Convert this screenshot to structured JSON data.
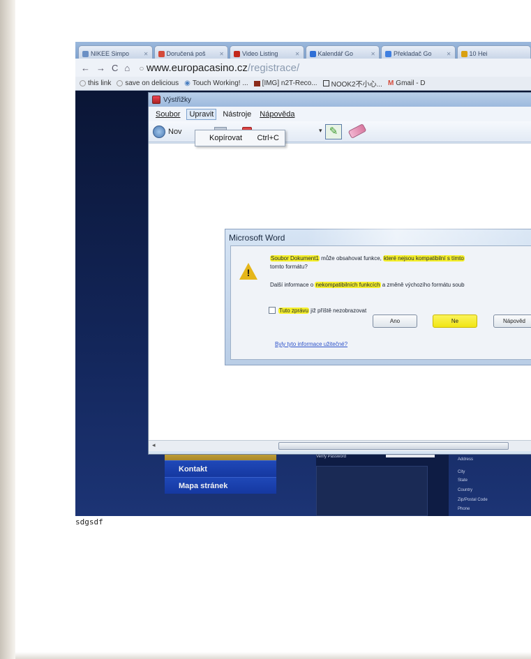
{
  "browser": {
    "tabs": [
      {
        "label": "NIKEE Simpo",
        "icon_color": "#6b8fc4"
      },
      {
        "label": "Doručená poš",
        "icon_color": "#d44a3a"
      },
      {
        "label": "Video Listing",
        "icon_color": "#c2281c"
      },
      {
        "label": "Kalendář Go",
        "icon_color": "#2f6fd6"
      },
      {
        "label": "Překladač Go",
        "icon_color": "#3f7fe0"
      },
      {
        "label": "10 Hei",
        "icon_color": "#d9a011"
      }
    ],
    "back_icon": "back-arrow-icon",
    "forward_icon": "forward-arrow-icon",
    "reload_icon": "reload-icon",
    "home_icon": "home-icon",
    "url_domain": "www.europacasino.cz",
    "url_path": "/registrace/",
    "bookmarks": [
      "this link",
      "save on delicious",
      "Touch Working! ...",
      "[IMG] n2T-Reco...",
      "NOOK2不小心...",
      "Gmail - D"
    ]
  },
  "site": {
    "nav_items": [
      "Kontakt",
      "Mapa stránek"
    ],
    "form_labels_left": [
      "Verify Password"
    ],
    "form_labels_right": [
      "Address",
      "City",
      "State",
      "Country",
      "Zip/Postal Code",
      "Phone"
    ]
  },
  "snip_window": {
    "title": "Výstřižky",
    "menu": [
      {
        "label": "Soubor",
        "open": false
      },
      {
        "label": "Upravit",
        "open": true
      },
      {
        "label": "Nástroje",
        "open": false
      },
      {
        "label": "Nápověda",
        "open": false
      }
    ],
    "toolbar_new_label": "Nov",
    "dropdown": {
      "item": "Kopírovat",
      "shortcut": "Ctrl+C"
    }
  },
  "word_dialog": {
    "title": "Microsoft Word",
    "line1_a": "Soubor Dokument1",
    "line1_b": " může obsahovat funkce, ",
    "line1_c": "které nejsou kompatibilní s tímto",
    "line2": "tomto formátu?",
    "line3_a": "Další informace o ",
    "line3_b": "nekompatibilních funkcích",
    "line3_c": " a změně výchozího formátu soub",
    "checkbox_a": "Tuto zprávu",
    "checkbox_b": " již příště nezobrazovat",
    "buttons": [
      "Ano",
      "Ne",
      "Nápověd"
    ],
    "link": "Byly tyto informace užitečné?",
    "highlight_color": "#f6f02a"
  },
  "caption": "sdgsdf"
}
